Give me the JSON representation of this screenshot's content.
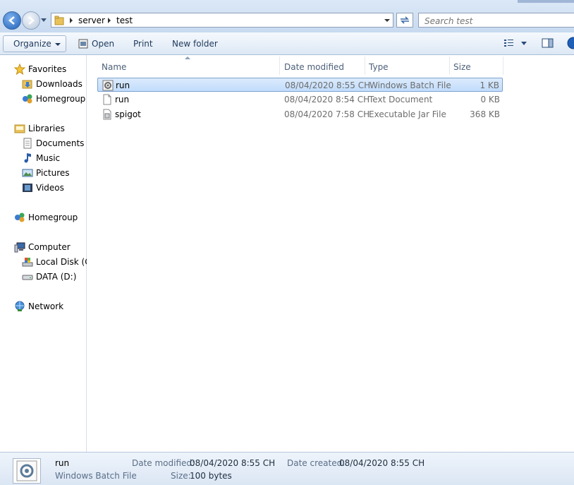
{
  "address": {
    "crumbs": [
      "server",
      "test"
    ],
    "search_placeholder": "Search test"
  },
  "toolbar": {
    "organize": "Organize",
    "open": "Open",
    "print": "Print",
    "new_folder": "New folder"
  },
  "nav": {
    "favorites": "Favorites",
    "downloads": "Downloads",
    "homegroup_fav": "Homegroup",
    "libraries": "Libraries",
    "documents": "Documents",
    "music": "Music",
    "pictures": "Pictures",
    "videos": "Videos",
    "homegroup": "Homegroup",
    "computer": "Computer",
    "local_disk": "Local Disk (C:",
    "data_disk": "DATA (D:)",
    "network": "Network"
  },
  "columns": {
    "name": "Name",
    "date": "Date modified",
    "type": "Type",
    "size": "Size"
  },
  "files": [
    {
      "name": "run",
      "date": "08/04/2020 8:55 CH",
      "type": "Windows Batch File",
      "size": "1 KB",
      "icon": "batch-file-icon",
      "selected": true
    },
    {
      "name": "run",
      "date": "08/04/2020 8:54 CH",
      "type": "Text Document",
      "size": "0 KB",
      "icon": "text-file-icon",
      "selected": false
    },
    {
      "name": "spigot",
      "date": "08/04/2020 7:58 CH",
      "type": "Executable Jar File",
      "size": "368 KB",
      "icon": "jar-file-icon",
      "selected": false
    }
  ],
  "details": {
    "name": "run",
    "type": "Windows Batch File",
    "date_modified_label": "Date modified:",
    "date_modified": "08/04/2020 8:55 CH",
    "date_created_label": "Date created:",
    "date_created": "08/04/2020 8:55 CH",
    "size_label": "Size:",
    "size": "100 bytes"
  },
  "colors": {
    "selection": "#c9e0fb",
    "chrome": "#dbe8f7",
    "accent": "#1f5fb8"
  }
}
